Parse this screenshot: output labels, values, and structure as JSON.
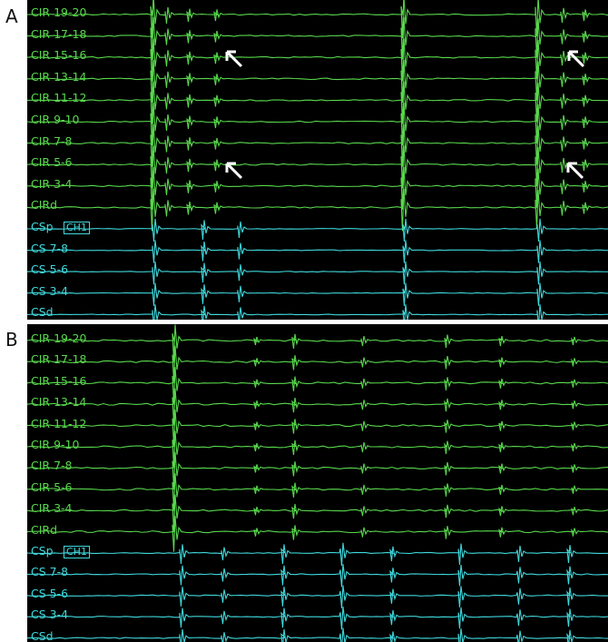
{
  "panels": [
    {
      "letter": "A",
      "channels": [
        "CIR 19-20",
        "CIR 17-18",
        "CIR 15-16",
        "CIR 13-14",
        "CIR 11-12",
        "CIR 9-10",
        "CIR 7-8",
        "CIR 5-6",
        "CIR 3-4",
        "CIRd",
        "CSp",
        "CS 7-8",
        "CS 5-6",
        "CS 3-4",
        "CSd"
      ],
      "marker": "CH1"
    },
    {
      "letter": "B",
      "channels": [
        "CIR 19-20",
        "CIR 17-18",
        "CIR 15-16",
        "CIR 13-14",
        "CIR 11-12",
        "CIR 9-10",
        "CIR 7-8",
        "CIR 5-6",
        "CIR 3-4",
        "CIRd",
        "CSp",
        "CS 7-8",
        "CS 5-6",
        "CS 3-4",
        "CSd"
      ],
      "marker": "CH1"
    }
  ],
  "colors": {
    "cir": "#58d84c",
    "cs": "#3fd8dc",
    "background": "#000000",
    "arrow": "#ffffff"
  },
  "icons": [
    "arrow-icon"
  ]
}
